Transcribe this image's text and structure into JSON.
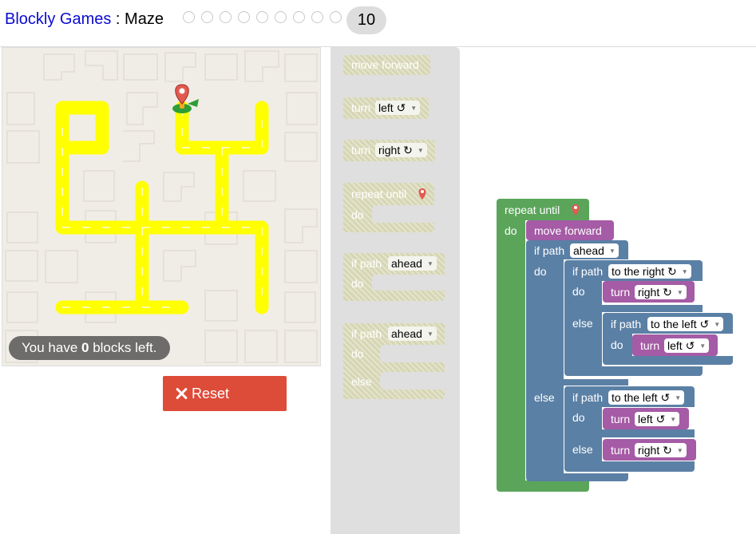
{
  "header": {
    "app_link": "Blockly Games",
    "separator": " : ",
    "game": "Maze",
    "current_level": "10"
  },
  "maze": {
    "blocks_left_prefix": "You have ",
    "blocks_left_count": "0",
    "blocks_left_suffix": " blocks left."
  },
  "controls": {
    "reset_label": "Reset"
  },
  "colors": {
    "path": "#ffff00",
    "loop_block": "#5ba55b",
    "action_block": "#a55ba5",
    "logic_block": "#5b80a5",
    "reset_button": "#dd4b39",
    "link": "#0b0bd0"
  },
  "toolbox": {
    "move_forward": "move forward",
    "turn": "turn",
    "left": "left ↺",
    "right": "right ↻",
    "repeat_until": "repeat until",
    "do": "do",
    "else": "else",
    "if_path": "if path",
    "ahead": "ahead"
  },
  "workspace": {
    "repeat_until": "repeat until",
    "do": "do",
    "else": "else",
    "move_forward": "move forward",
    "if_path": "if path",
    "turn": "turn",
    "ahead": "ahead",
    "to_the_right": "to the right ↻",
    "to_the_left": "to the left ↺",
    "right": "right ↻",
    "left": "left ↺"
  }
}
